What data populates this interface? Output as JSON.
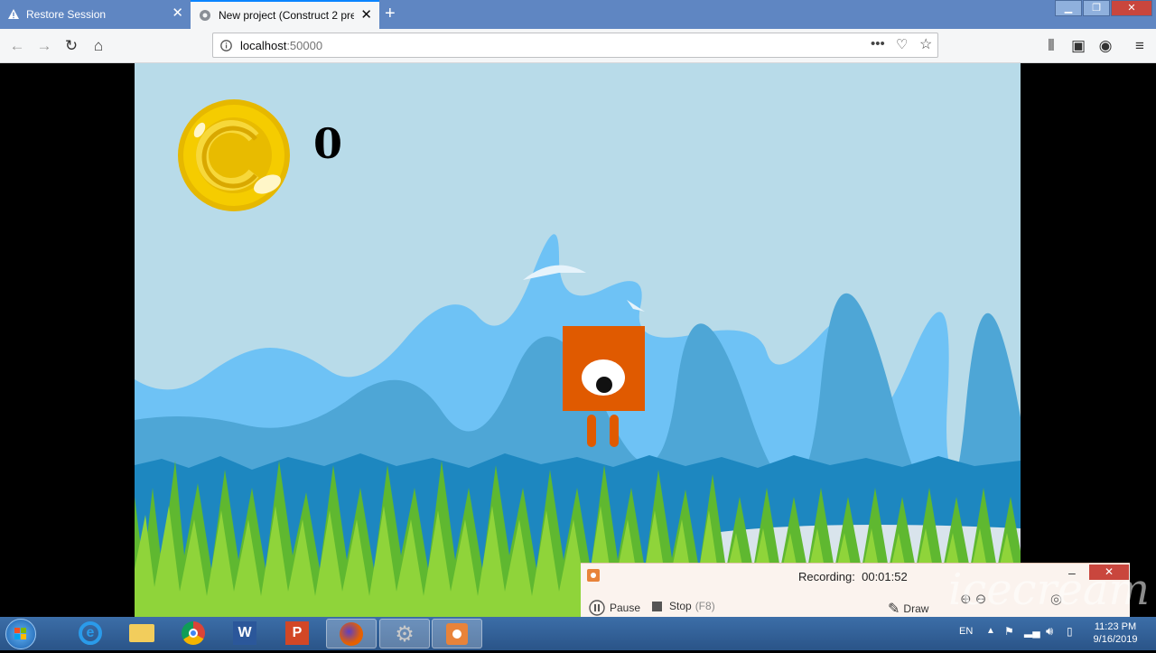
{
  "browser": {
    "tabs": [
      {
        "label": "Restore Session",
        "icon": "warning-icon"
      },
      {
        "label": "New project (Construct 2 previ",
        "icon": "construct-icon"
      }
    ],
    "url_host": "localhost",
    "url_port": ":50000"
  },
  "game": {
    "score": "0",
    "colors": {
      "sky": "#b8dbe9",
      "player": "#e05a00",
      "coin": "#f2c800"
    }
  },
  "recorder": {
    "status_label": "Recording:",
    "time": "00:01:52",
    "pause_label": "Pause",
    "stop_label": "Stop",
    "stop_key": "(F8)",
    "draw_label": "Draw"
  },
  "watermark": "icecream",
  "taskbar": {
    "language": "EN",
    "time": "11:23 PM",
    "date": "9/16/2019"
  }
}
